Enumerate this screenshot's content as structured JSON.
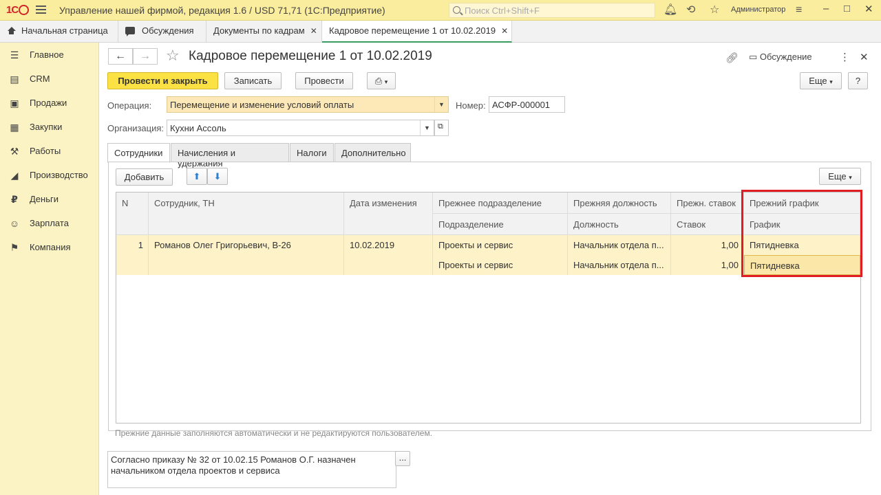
{
  "titlebar": {
    "logo": "1С",
    "app_title": "Управление нашей фирмой, редакция 1.6 / USD 71,71  (1С:Предприятие)",
    "search_placeholder": "Поиск Ctrl+Shift+F",
    "user": "Администратор"
  },
  "open_tabs": [
    {
      "label": "Начальная страница"
    },
    {
      "label": "Обсуждения"
    },
    {
      "label": "Документы по кадрам"
    },
    {
      "label": "Кадровое перемещение 1 от 10.02.2019"
    }
  ],
  "sidebar": {
    "items": [
      {
        "label": "Главное",
        "icon": "list-icon"
      },
      {
        "label": "CRM",
        "icon": "contacts-icon"
      },
      {
        "label": "Продажи",
        "icon": "basket-icon"
      },
      {
        "label": "Закупки",
        "icon": "grid-icon"
      },
      {
        "label": "Работы",
        "icon": "tools-icon"
      },
      {
        "label": "Производство",
        "icon": "factory-icon"
      },
      {
        "label": "Деньги",
        "icon": "money-icon"
      },
      {
        "label": "Зарплата",
        "icon": "people-icon"
      },
      {
        "label": "Компания",
        "icon": "flag-icon"
      }
    ]
  },
  "document": {
    "title": "Кадровое перемещение 1 от 10.02.2019",
    "discussion": "Обсуждение",
    "toolbar": {
      "post_close": "Провести и закрыть",
      "save": "Записать",
      "post": "Провести",
      "more": "Еще",
      "help": "?"
    },
    "operation_label": "Операция:",
    "operation_value": "Перемещение и изменение условий оплаты",
    "number_label": "Номер:",
    "number_value": "АСФР-000001",
    "org_label": "Организация:",
    "org_value": "Кухни Ассоль",
    "tabs": [
      "Сотрудники",
      "Начисления и удержания",
      "Налоги",
      "Дополнительно"
    ],
    "add_button": "Добавить",
    "table_more": "Еще",
    "columns": {
      "n": "N",
      "employee": "Сотрудник, ТН",
      "date": "Дата изменения",
      "prev_dept": "Прежнее подразделение",
      "dept": "Подразделение",
      "prev_pos": "Прежняя должность",
      "pos": "Должность",
      "prev_rate": "Прежн. ставок",
      "rate": "Ставок",
      "prev_schedule": "Прежний график",
      "schedule": "График"
    },
    "rows": [
      {
        "n": "1",
        "employee": "Романов Олег Григорьевич, В-26",
        "date": "10.02.2019",
        "prev_dept": "Проекты и сервис",
        "dept": "Проекты и сервис",
        "prev_pos": "Начальник отдела п...",
        "pos": "Начальник отдела п...",
        "prev_rate": "1,00",
        "rate": "1,00",
        "prev_schedule": "Пятидневка",
        "schedule": "Пятидневка"
      }
    ],
    "hint": "Прежние данные заполняются автоматически и не редактируются пользователем.",
    "comment": "Согласно приказу № 32 от 10.02.15 Романов О.Г. назначен начальником отдела проектов и сервиса",
    "comment_button": "..."
  }
}
